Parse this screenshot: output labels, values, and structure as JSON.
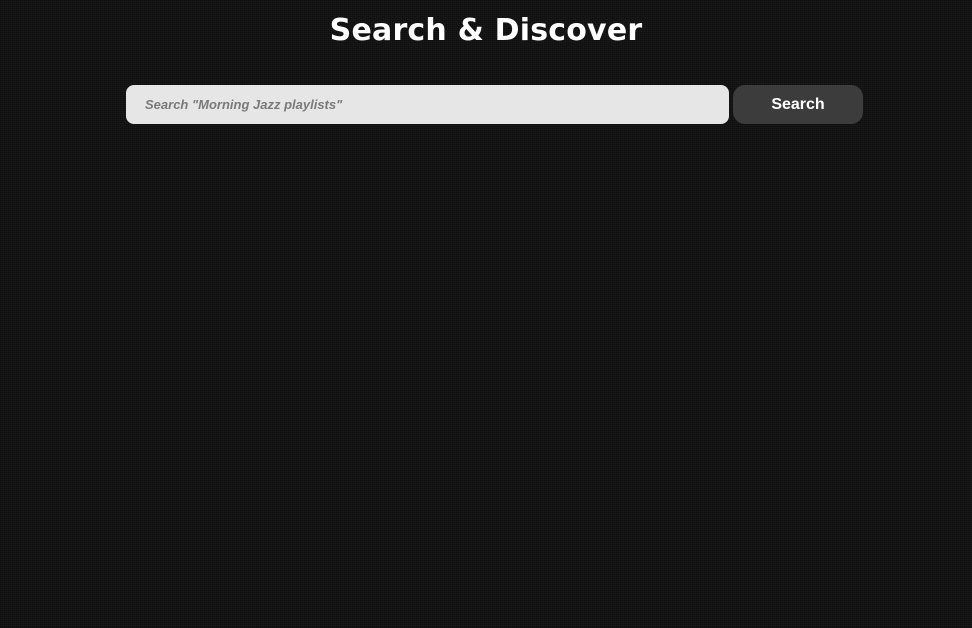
{
  "header": {
    "title": "Search & Discover"
  },
  "search": {
    "placeholder": "Search \"Morning Jazz playlists\"",
    "value": "",
    "button_label": "Search"
  },
  "results": {
    "items": []
  },
  "colors": {
    "background": "#141414",
    "input_background": "#e6e6e6",
    "button_background": "#3c3c3c",
    "title_text": "#ffffff"
  }
}
